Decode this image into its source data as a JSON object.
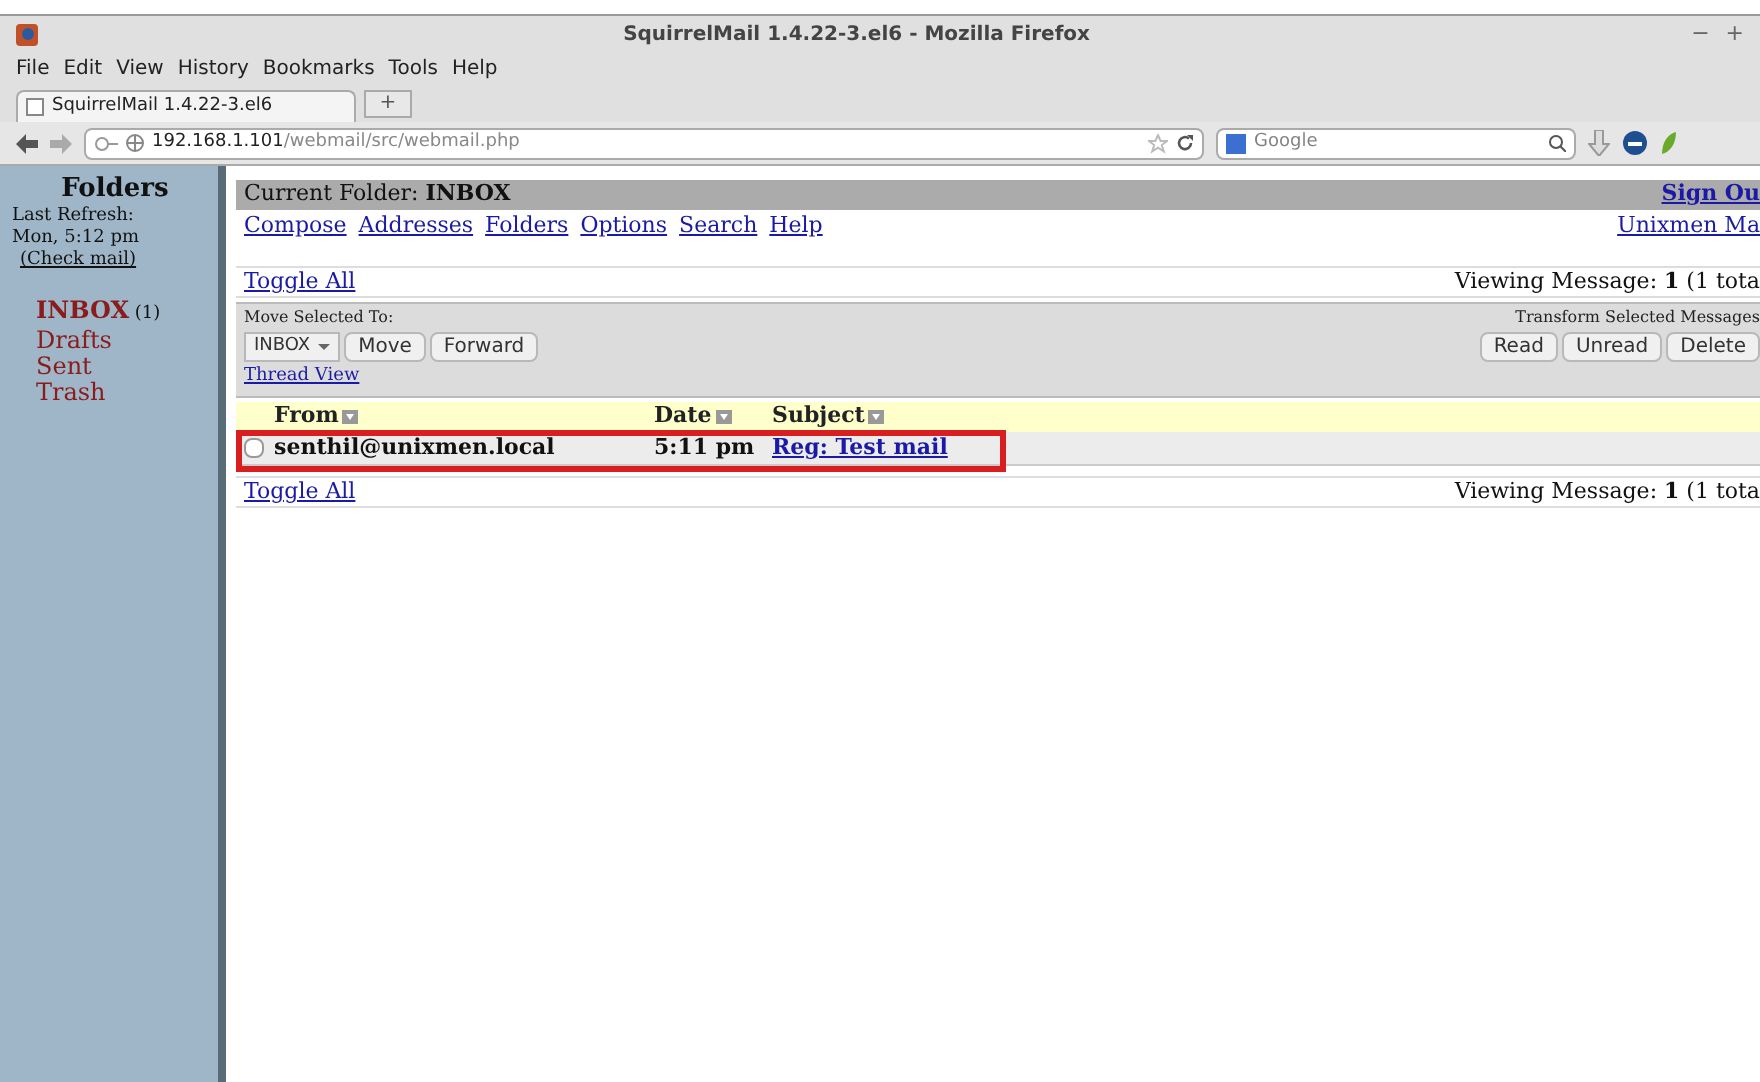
{
  "window": {
    "title": "SquirrelMail 1.4.22-3.el6 - Mozilla Firefox",
    "controls": [
      "−",
      "+"
    ]
  },
  "menu": [
    "File",
    "Edit",
    "View",
    "History",
    "Bookmarks",
    "Tools",
    "Help"
  ],
  "tabs": [
    {
      "label": "SquirrelMail 1.4.22-3.el6",
      "selected": true
    }
  ],
  "new_tab": "+",
  "address": {
    "host": "192.168.1.101",
    "path": "/webmail/src/webmail.php"
  },
  "search": {
    "placeholder": "Google"
  },
  "sidebar": {
    "title": "Folders",
    "refresh_label": "Last Refresh:",
    "refresh_time": "Mon, 5:12 pm",
    "check_mail": "(Check mail)",
    "folders": [
      {
        "name": "INBOX",
        "count": "(1)",
        "selected": true
      },
      {
        "name": "Drafts",
        "selected": false
      },
      {
        "name": "Sent",
        "selected": false
      },
      {
        "name": "Trash",
        "selected": false
      }
    ]
  },
  "header": {
    "current_folder_label": "Current Folder:",
    "current_folder": "INBOX",
    "sign_out": "Sign Ou",
    "links": [
      "Compose",
      "Addresses",
      "Folders",
      "Options",
      "Search",
      "Help"
    ],
    "org_link": "Unixmen Ma"
  },
  "toggle_all": "Toggle All",
  "viewing": "Viewing Message: **1** (1 tota",
  "move": {
    "label": "Move Selected To:",
    "select": "INBOX",
    "buttons": [
      "Move",
      "Forward"
    ],
    "thread_view": "Thread View"
  },
  "transform": {
    "label": "Transform Selected Messages",
    "buttons": [
      "Read",
      "Unread",
      "Delete"
    ]
  },
  "columns": [
    "From",
    "Date",
    "Subject"
  ],
  "messages": [
    {
      "checked": false,
      "from": "senthil@unixmen.local",
      "date": "5:11 pm",
      "subject": "Reg: Test mail"
    }
  ],
  "footer": {
    "toggle_all": "Toggle All",
    "viewing": "Viewing Message: **1** (1 tota"
  }
}
